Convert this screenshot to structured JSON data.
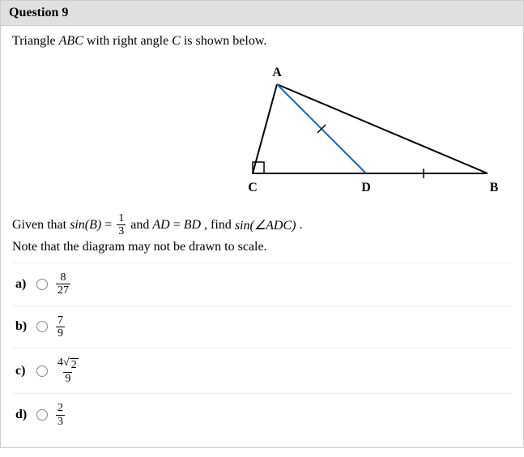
{
  "header": {
    "title": "Question 9"
  },
  "prompt": {
    "line1_part1": "Triangle ",
    "line1_triangle": "ABC",
    "line1_part2": " with right angle ",
    "line1_angle": "C",
    "line1_part3": " is shown below."
  },
  "figure": {
    "labels": {
      "A": "A",
      "B": "B",
      "C": "C",
      "D": "D"
    }
  },
  "given": {
    "pre": "Given that  ",
    "sinB_label": "sin(B)",
    "eq1": " = ",
    "frac_sinB_num": "1",
    "frac_sinB_den": "3",
    "and": "  and  ",
    "AD": "AD",
    "eq2": " = ",
    "BD": "BD",
    "findPre": " , find ",
    "sinADC_sin": "sin",
    "sinADC_arg": "(∠ADC)",
    "period": "."
  },
  "note": "Note that the diagram may not be drawn to scale.",
  "options": [
    {
      "letter": "a)",
      "type": "frac",
      "num": "8",
      "den": "27"
    },
    {
      "letter": "b)",
      "type": "frac",
      "num": "7",
      "den": "9"
    },
    {
      "letter": "c)",
      "type": "frac_sqrt",
      "coef": "4",
      "rad": "2",
      "den": "9"
    },
    {
      "letter": "d)",
      "type": "frac",
      "num": "2",
      "den": "3"
    }
  ]
}
